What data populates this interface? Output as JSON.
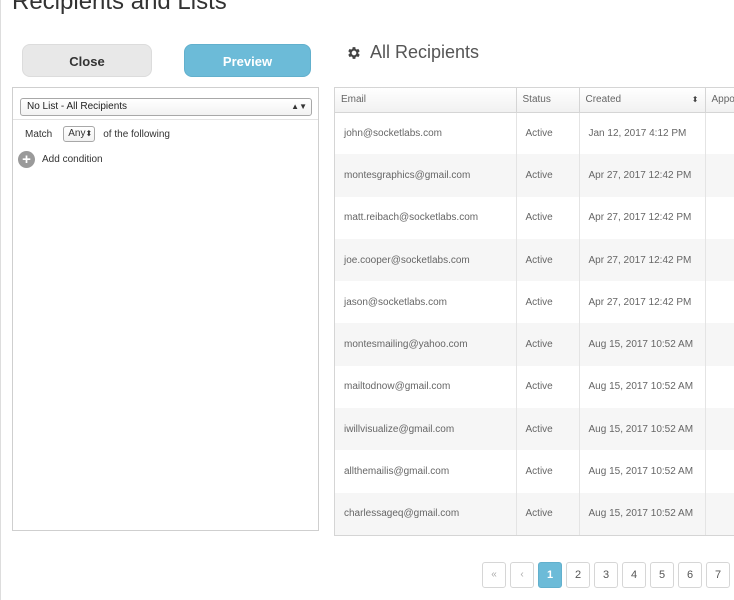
{
  "modal": {
    "title": "Recipients and Lists"
  },
  "actions": {
    "close_label": "Close",
    "preview_label": "Preview"
  },
  "filter": {
    "list_value": "No List - All Recipients",
    "match_label": "Match",
    "match_value": "Any",
    "match_suffix": "of the following",
    "add_condition_label": "Add condition"
  },
  "section": {
    "title": "All Recipients"
  },
  "table": {
    "headers": [
      "Email",
      "Status",
      "Created",
      "Appo"
    ],
    "rows": [
      [
        "john@socketlabs.com",
        "Active",
        "Jan 12, 2017 4:12 PM"
      ],
      [
        "montesgraphics@gmail.com",
        "Active",
        "Apr 27, 2017 12:42 PM"
      ],
      [
        "matt.reibach@socketlabs.com",
        "Active",
        "Apr 27, 2017 12:42 PM"
      ],
      [
        "joe.cooper@socketlabs.com",
        "Active",
        "Apr 27, 2017 12:42 PM"
      ],
      [
        "jason@socketlabs.com",
        "Active",
        "Apr 27, 2017 12:42 PM"
      ],
      [
        "montesmailing@yahoo.com",
        "Active",
        "Aug 15, 2017 10:52 AM"
      ],
      [
        "mailtodnow@gmail.com",
        "Active",
        "Aug 15, 2017 10:52 AM"
      ],
      [
        "iwillvisualize@gmail.com",
        "Active",
        "Aug 15, 2017 10:52 AM"
      ],
      [
        "allthemailis@gmail.com",
        "Active",
        "Aug 15, 2017 10:52 AM"
      ],
      [
        "charlessageq@gmail.com",
        "Active",
        "Aug 15, 2017 10:52 AM"
      ]
    ]
  },
  "pagination": {
    "first_label": "«",
    "prev_label": "‹",
    "pages": [
      "1",
      "2",
      "3",
      "4",
      "5",
      "6",
      "7"
    ],
    "active_page": "1"
  },
  "colors": {
    "accent": "#6cbbd8",
    "button_gray": "#e8e8e8",
    "row_stripe": "#f6f6f6"
  },
  "icons": {
    "section": "gear-icon",
    "add": "plus-circle-icon",
    "sort": "sort-icon"
  }
}
